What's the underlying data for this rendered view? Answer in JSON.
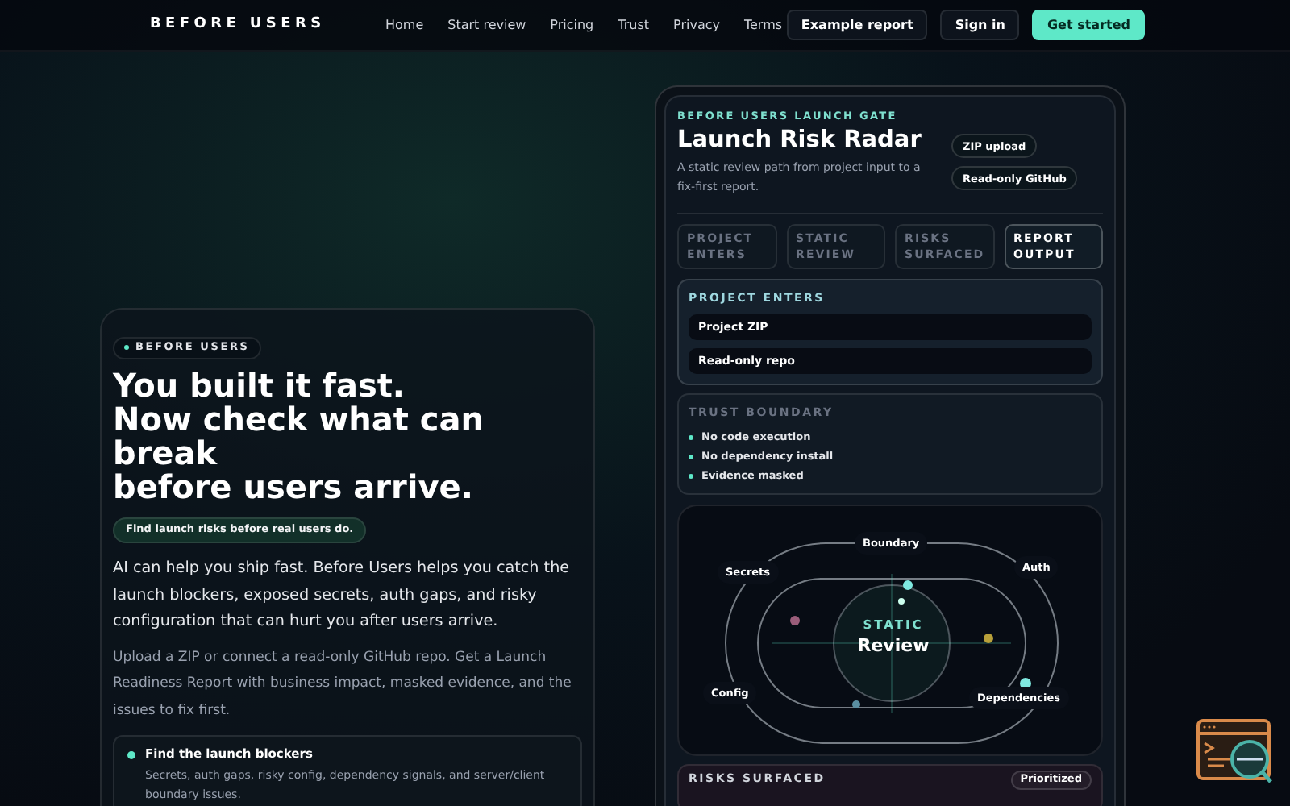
{
  "nav": {
    "brand": "BEFORE USERS",
    "links": [
      "Home",
      "Start review",
      "Pricing",
      "Trust",
      "Privacy",
      "Terms"
    ],
    "buttons": [
      {
        "label": "Example report",
        "kind": "ghost"
      },
      {
        "label": "Sign in",
        "kind": "ghost"
      },
      {
        "label": "Get started",
        "kind": "primary"
      }
    ]
  },
  "hero": {
    "eyebrow": "BEFORE USERS",
    "headline": [
      "You built it fast.",
      "Now check what can break",
      "before users arrive."
    ],
    "tagline": "Find launch risks before real users do.",
    "lead": "AI can help you ship fast. Before Users helps you catch the launch blockers, exposed secrets, auth gaps, and risky configuration that can hurt you after users arrive.",
    "body": "Upload a ZIP or connect a read-only GitHub repo. Get a Launch Readiness Report with business impact, masked evidence, and the issues to fix first.",
    "features": [
      {
        "title": "Find the launch blockers",
        "text": "Secrets, auth gaps, risky config, dependency signals, and server/client boundary issues."
      }
    ]
  },
  "panel": {
    "eyebrow": "BEFORE USERS LAUNCH GATE",
    "title": "Launch Risk Radar",
    "subtitle": "A static review path from project input to a fix-first report.",
    "chips": [
      "ZIP upload",
      "Read-only GitHub"
    ],
    "tabs": [
      {
        "label": "PROJECT ENTERS",
        "selected": false
      },
      {
        "label": "STATIC REVIEW",
        "selected": false
      },
      {
        "label": "RISKS SURFACED",
        "selected": false
      },
      {
        "label": "REPORT OUTPUT",
        "selected": true
      }
    ],
    "project_enters": {
      "heading": "PROJECT ENTERS",
      "items": [
        "Project ZIP",
        "Read-only repo"
      ]
    },
    "trust_boundary": {
      "heading": "TRUST BOUNDARY",
      "items": [
        "No code execution",
        "No dependency install",
        "Evidence masked"
      ]
    },
    "radar": {
      "center_eyebrow": "STATIC",
      "center_title": "Review",
      "labels": [
        "Boundary",
        "Secrets",
        "Auth",
        "Config",
        "Dependencies"
      ]
    },
    "risks": {
      "heading": "RISKS SURFACED",
      "badge": "Prioritized"
    }
  }
}
